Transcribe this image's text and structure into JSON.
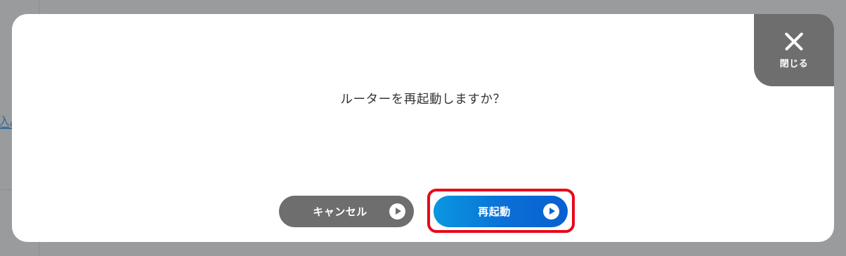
{
  "background": {
    "link_fragment": "込み"
  },
  "dialog": {
    "message": "ルーターを再起動しますか？",
    "close": {
      "label": "閉じる",
      "icon": "close-icon"
    },
    "buttons": {
      "cancel_label": "キャンセル",
      "restart_label": "再起動",
      "icon": "play-circle-icon"
    }
  },
  "colors": {
    "overlay": "#9a9b9d",
    "dialog_bg": "#ffffff",
    "close_tab": "#6e6e6e",
    "cancel_button": "#6e6e6e",
    "restart_button_start": "#0a97e0",
    "restart_button_end": "#0a5fd0",
    "highlight": "#e8081a",
    "message_text": "#333333"
  }
}
